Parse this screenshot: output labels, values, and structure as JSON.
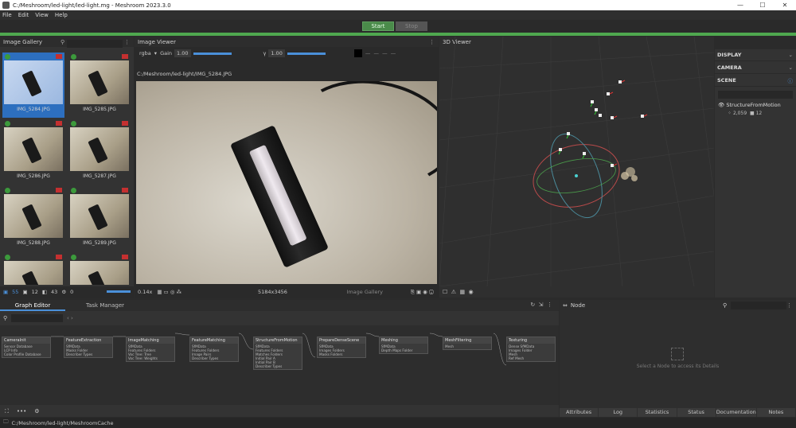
{
  "window": {
    "title": "C:/Meshroom/led-light/led-light.mg - Meshroom 2023.3.0",
    "buttons": [
      "—",
      "☐",
      "✕"
    ]
  },
  "menu": [
    "File",
    "Edit",
    "View",
    "Help"
  ],
  "run": {
    "start": "Start",
    "stop": "Stop"
  },
  "gallery": {
    "title": "Image Gallery",
    "items": [
      "IMG_5284.JPG",
      "IMG_5285.JPG",
      "IMG_5286.JPG",
      "IMG_5287.JPG",
      "IMG_5288.JPG",
      "IMG_5289.JPG"
    ],
    "selected_index": 0,
    "footer": {
      "cameras": "55",
      "intrinsics": "12",
      "reconstructed": "43",
      "rejected": "0"
    }
  },
  "viewer": {
    "title": "Image Viewer",
    "channel": "rgba",
    "gain_label": "Gain",
    "gain": "1.00",
    "gamma_label": "γ",
    "gamma": "1.00",
    "path": "C:/Meshroom/led-light/IMG_5284.JPG",
    "zoom": "0.14x",
    "resolution": "5184x3456",
    "source": "Image Gallery"
  },
  "viewer3d": {
    "title": "3D Viewer"
  },
  "sidepanel": {
    "display": "DISPLAY",
    "camera": "CAMERA",
    "scene": "SCENE",
    "node_name": "StructureFromMotion",
    "points": "2,059",
    "cameras": "12"
  },
  "graph": {
    "tabs": [
      "Graph Editor",
      "Task Manager"
    ],
    "nodes": [
      {
        "title": "CameraInit",
        "ports": [
          "Sensor Database",
          "LCP Info",
          "Color Profile Database"
        ]
      },
      {
        "title": "FeatureExtraction",
        "ports": [
          "SfMData",
          "Masks Folder",
          "Describer Types"
        ]
      },
      {
        "title": "ImageMatching",
        "ports": [
          "SfMData",
          "Features Folders",
          "Voc Tree: Tree",
          "Voc Tree: Weights"
        ]
      },
      {
        "title": "FeatureMatching",
        "ports": [
          "SfMData",
          "Features Folders",
          "Image Pairs",
          "Describer Types"
        ]
      },
      {
        "title": "StructureFromMotion",
        "ports": [
          "SfMData",
          "Features Folders",
          "Matches Folders",
          "Initial Pair A",
          "Initial Pair B",
          "Describer Types"
        ]
      },
      {
        "title": "PrepareDenseScene",
        "ports": [
          "SfMData",
          "Images Folders",
          "Masks Folders"
        ]
      },
      {
        "title": "Meshing",
        "ports": [
          "SfMData",
          "Depth Maps Folder"
        ]
      },
      {
        "title": "MeshFiltering",
        "ports": [
          "Mesh"
        ]
      },
      {
        "title": "Texturing",
        "ports": [
          "Dense SfMData",
          "Images Folder",
          "Mesh",
          "Ref Mesh"
        ]
      }
    ]
  },
  "nodepanel": {
    "title": "Node",
    "empty": "Select a Node to access its Details",
    "tabs": [
      "Attributes",
      "Log",
      "Statistics",
      "Status",
      "Documentation",
      "Notes"
    ]
  },
  "status": {
    "path": "C:/Meshroom/led-light/MeshroomCache"
  }
}
